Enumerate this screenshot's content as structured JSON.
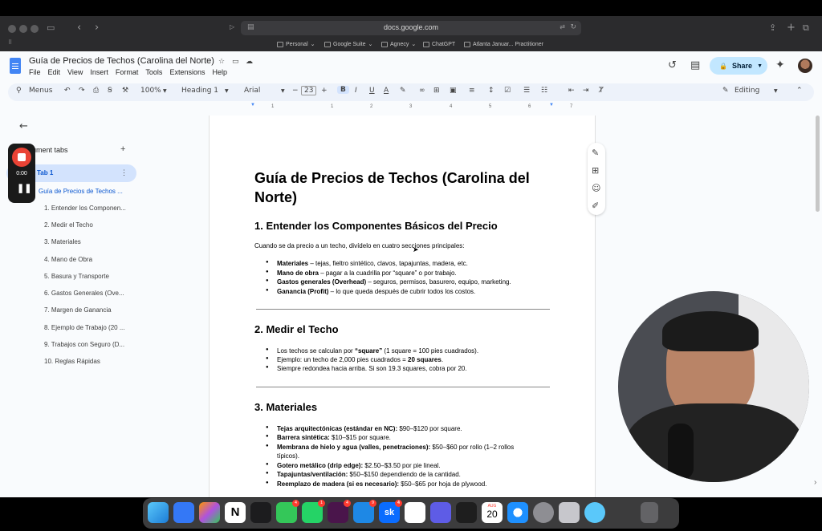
{
  "browser": {
    "url": "docs.google.com",
    "bookmarks": [
      "Personal",
      "Google Suite",
      "Agnecy",
      "ChatGPT",
      "Atlanta Januar... Practitioner"
    ]
  },
  "docs": {
    "title": "Guía de Precios de Techos (Carolina del Norte)",
    "menu": [
      "File",
      "Edit",
      "View",
      "Insert",
      "Format",
      "Tools",
      "Extensions",
      "Help"
    ],
    "share_label": "Share",
    "toolbar": {
      "menus_label": "Menus",
      "zoom": "100%",
      "style": "Heading 1",
      "font": "Arial",
      "font_size": "23",
      "mode": "Editing"
    },
    "ruler_numbers": [
      "1",
      "1",
      "2",
      "3",
      "4",
      "5",
      "6",
      "7"
    ]
  },
  "sidebar": {
    "tabs_label": "Document tabs",
    "tab_name": "Tab 1",
    "heading_item": "Guía de Precios de Techos ...",
    "outline": [
      "1. Entender los Componen...",
      "2. Medir el Techo",
      "3. Materiales",
      "4. Mano de Obra",
      "5. Basura y Transporte",
      "6. Gastos Generales (Ove...",
      "7. Margen de Ganancia",
      "8. Ejemplo de Trabajo (20 ...",
      "9. Trabajos con Seguro (D...",
      "10. Reglas Rápidas"
    ]
  },
  "recorder": {
    "time": "0:00"
  },
  "document": {
    "title_line1": "Guía de Precios de Techos (Carolina del",
    "title_line2": "Norte)",
    "s1_heading": "1. Entender los Componentes Básicos del Precio",
    "s1_intro": "Cuando se da precio a un techo, divídelo en cuatro secciones principales:",
    "s1_items": [
      {
        "bold": "Materiales",
        "text": " – tejas, fieltro sintético, clavos, tapajuntas, madera, etc."
      },
      {
        "bold": "Mano de obra",
        "text": " – pagar a la cuadrilla por “square” o por trabajo."
      },
      {
        "bold": "Gastos generales (Overhead)",
        "text": " – seguros, permisos, basurero, equipo, marketing."
      },
      {
        "bold": "Ganancia (Profit)",
        "text": " – lo que queda después de cubrir todos los costos."
      }
    ],
    "s2_heading": "2. Medir el Techo",
    "s2_item1_a": "Los techos se calculan por ",
    "s2_item1_b": "“square”",
    "s2_item1_c": " (1 square = 100 pies cuadrados).",
    "s2_item2_a": "Ejemplo: un techo de 2,000 pies cuadrados = ",
    "s2_item2_b": "20 squares",
    "s2_item2_c": ".",
    "s2_item3": "Siempre redondea hacia arriba. Si son 19.3 squares, cobra por 20.",
    "s3_heading": "3. Materiales",
    "s3_items": [
      {
        "bold": "Tejas arquitectónicas (estándar en NC):",
        "text": " $90–$120 por square."
      },
      {
        "bold": "Barrera sintética:",
        "text": " $10–$15 por square."
      },
      {
        "bold": "Membrana de hielo y agua (valles, penetraciones):",
        "text": " $50–$60 por rollo (1–2 rollos"
      },
      {
        "bold": "Gotero metálico (drip edge):",
        "text": " $2.50–$3.50 por pie lineal."
      },
      {
        "bold": "Tapajuntas/ventilación:",
        "text": " $50–$150 dependiendo de la cantidad."
      },
      {
        "bold": "Reemplazo de madera (si es necesario):",
        "text": " $50–$65 por hoja de plywood."
      }
    ],
    "s3_item3_cont": "típicos)."
  },
  "dock": {
    "calendar_month": "AUG",
    "calendar_day": "20",
    "badges": [
      "4",
      "1",
      "4",
      "9",
      "4"
    ]
  }
}
